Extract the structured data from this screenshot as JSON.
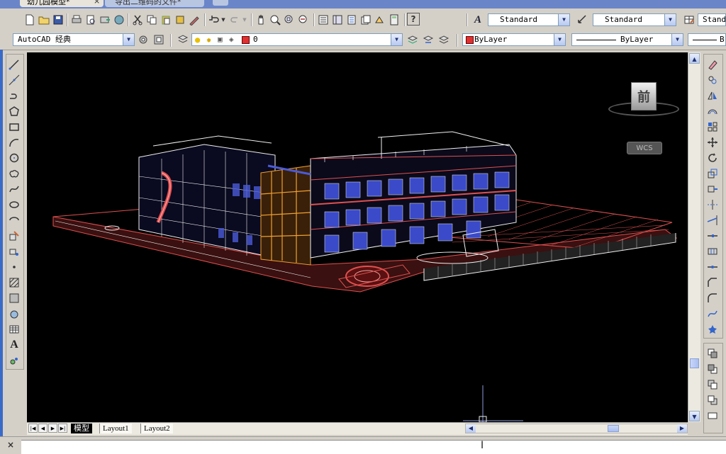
{
  "window_tabs": [
    {
      "label": "幼儿园模型*",
      "active": true
    },
    {
      "label": "导出二维码的文件*",
      "active": false
    }
  ],
  "styles_toolbar": {
    "text_style": "Standard",
    "dim_style": "Standard",
    "table_style": "Standard"
  },
  "workspace": "AutoCAD 经典",
  "layer": {
    "name": "0"
  },
  "properties": {
    "color": "ByLayer",
    "linetype": "ByLayer",
    "lineweight": "B"
  },
  "viewcube": {
    "face_label": "前",
    "wcs_label": "WCS"
  },
  "layout_tabs": [
    {
      "label": "模型",
      "active": true
    },
    {
      "label": "Layout1",
      "active": false
    },
    {
      "label": "Layout2",
      "active": false
    }
  ],
  "command_line": {
    "close_glyph": "×"
  },
  "colors": {
    "toolbar_bg": "#d4d0c8",
    "drawing_bg": "#000000",
    "model_red": "#e05050",
    "model_white": "#f0f0f0",
    "model_blue": "#4a5ad8",
    "model_orange": "#f0a030"
  }
}
